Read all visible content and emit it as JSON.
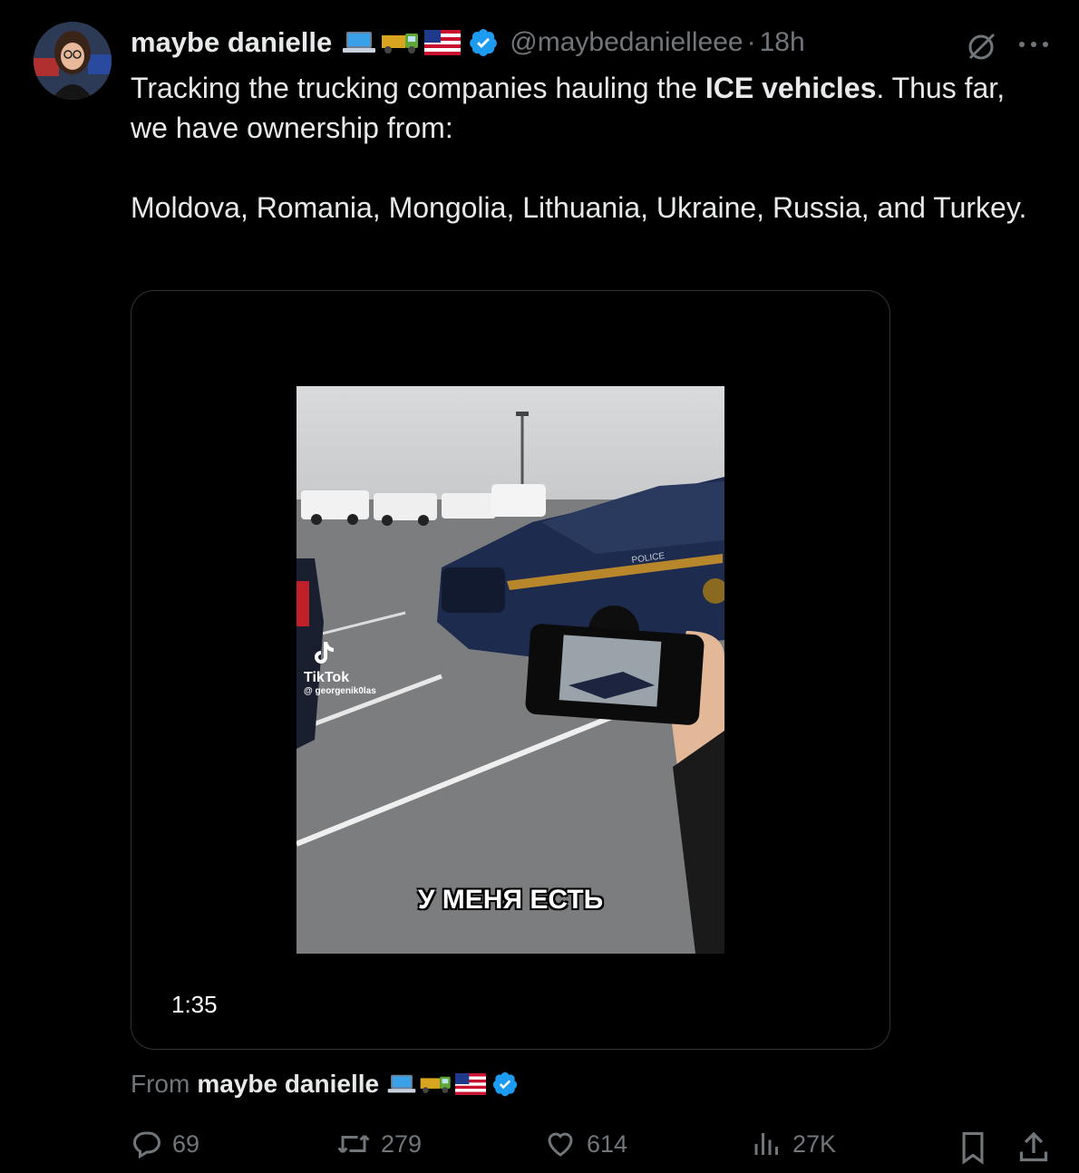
{
  "author": {
    "display_name": "maybe danielle",
    "handle": "@maybedanielleee",
    "separator": "·",
    "time_ago": "18h",
    "name_emoji": [
      "laptop-emoji",
      "truck-emoji",
      "us-flag-emoji"
    ],
    "verified": true
  },
  "tweet": {
    "text_part1": "Tracking the trucking companies hauling the ",
    "text_bold": "ICE vehicles",
    "text_part2": ". Thus far, we have ownership from:",
    "text_line2": "Moldova, Romania, Mongolia, Lithuania, Ukraine, Russia, and Turkey."
  },
  "media": {
    "type": "video",
    "duration": "1:35",
    "watermark_brand": "TikTok",
    "watermark_user": "@ georgenik0las",
    "subtitle": "У МЕНЯ ЕСТЬ",
    "police_text": "POLICE"
  },
  "from": {
    "label": "From",
    "name": "maybe danielle"
  },
  "actions": {
    "replies": "69",
    "reposts": "279",
    "likes": "614",
    "views": "27K"
  },
  "colors": {
    "background": "#000000",
    "text": "#e7e9ea",
    "muted": "#71767b",
    "verified_blue": "#1d9bf0",
    "border": "#2f3336"
  }
}
